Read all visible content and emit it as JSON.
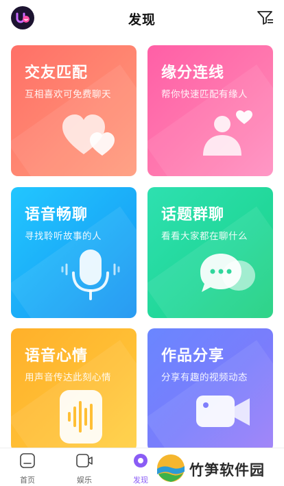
{
  "header": {
    "title": "发现",
    "logo_icon": "app-logo-icon",
    "filter_icon": "filter-icon"
  },
  "cards": [
    {
      "title": "交友匹配",
      "subtitle": "互相喜欢可免费聊天",
      "icon": "hearts-icon"
    },
    {
      "title": "缘分连线",
      "subtitle": "帮你快速匹配有缘人",
      "icon": "person-heart-icon"
    },
    {
      "title": "语音畅聊",
      "subtitle": "寻找聆听故事的人",
      "icon": "microphone-icon"
    },
    {
      "title": "话题群聊",
      "subtitle": "看看大家都在聊什么",
      "icon": "chat-bubbles-icon"
    },
    {
      "title": "语音心情",
      "subtitle": "用声音传达此刻心情",
      "icon": "voice-wave-icon"
    },
    {
      "title": "作品分享",
      "subtitle": "分享有趣的视频动态",
      "icon": "video-camera-icon"
    }
  ],
  "tabbar": {
    "items": [
      {
        "label": "首页",
        "icon": "home-icon"
      },
      {
        "label": "娱乐",
        "icon": "entertainment-icon"
      },
      {
        "label": "发现",
        "icon": "discover-icon",
        "active": true
      }
    ]
  },
  "watermark": {
    "text": "竹笋软件园"
  },
  "colors": {
    "accent": "#8a5cf5"
  }
}
